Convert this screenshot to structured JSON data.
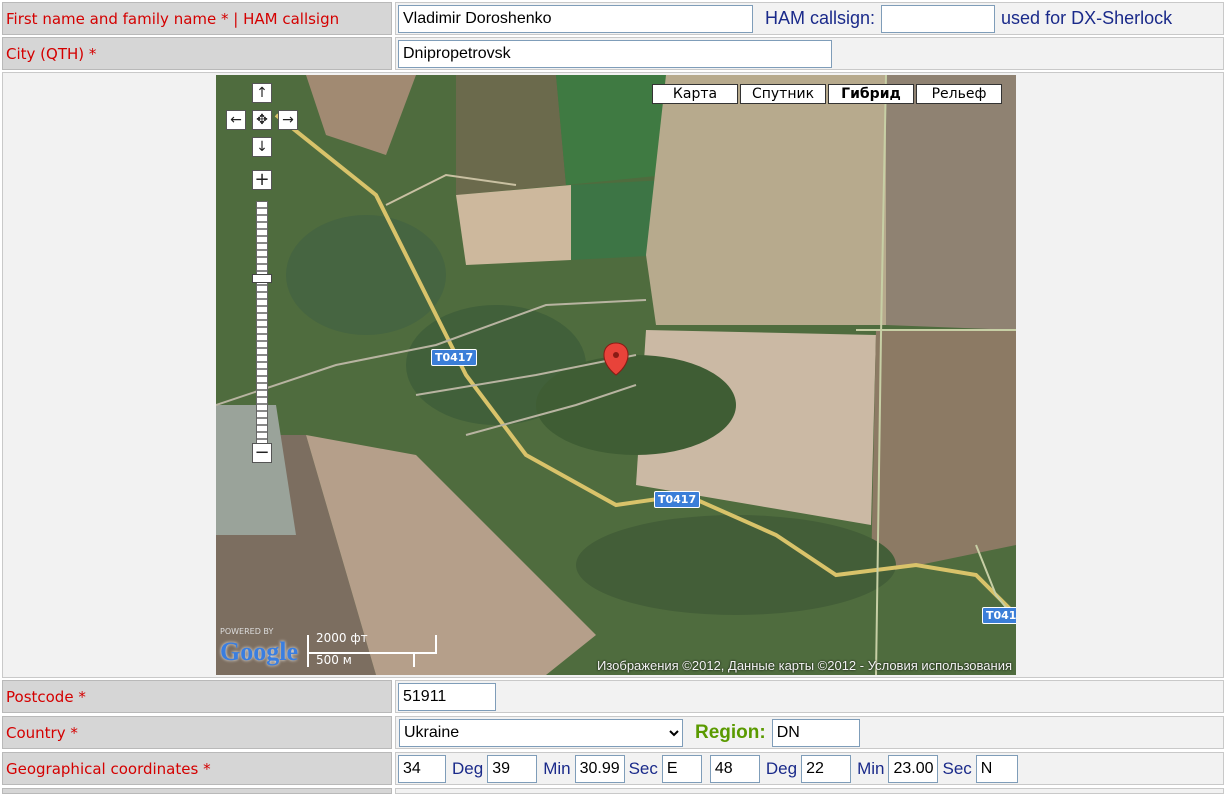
{
  "rows": {
    "name": {
      "label": "First name and family name *  |  HAM callsign",
      "value": "Vladimir Doroshenko",
      "callsign_label": "HAM callsign:",
      "callsign_value": "",
      "callsign_note": "used for DX-Sherlock"
    },
    "city": {
      "label": "City (QTH) *",
      "value": "Dnipropetrovsk"
    },
    "postcode": {
      "label": "Postcode *",
      "value": "51911"
    },
    "country": {
      "label": "Country *",
      "value": "Ukraine",
      "region_label": "Region:",
      "region_value": "DN"
    },
    "coords": {
      "label": "Geographical coordinates *",
      "lon_deg": "34",
      "lon_min": "39",
      "lon_sec": "30.99",
      "lon_dir": "E",
      "lat_deg": "48",
      "lat_min": "22",
      "lat_sec": "23.00",
      "lat_dir": "N",
      "deg_label": "Deg",
      "min_label": "Min",
      "sec_label": "Sec"
    }
  },
  "map": {
    "type_buttons": [
      "Карта",
      "Спутник",
      "Гибрид",
      "Рельеф"
    ],
    "selected_type": "Гибрид",
    "nav_up": "↑",
    "nav_left": "←",
    "nav_center": "✥",
    "nav_right": "→",
    "nav_down": "↓",
    "zoom_in": "+",
    "zoom_out": "−",
    "zoom_level_fraction": 0.34,
    "road_label": "T0417",
    "road_label_short": "T0417",
    "scale_ft": "2000 фт",
    "scale_m": "500 м",
    "logo_powered": "POWERED BY",
    "logo": "Google",
    "attribution": "Изображения ©2012, Данные карты ©2012 - Условия использования",
    "colors": {
      "marker": "#e8433a",
      "road": "#d9c36a",
      "water": "#3b7ed8"
    }
  },
  "colors": {
    "label_text": "#d40000",
    "inline_label": "#1a2a8a",
    "region_label": "#5a9a00"
  }
}
